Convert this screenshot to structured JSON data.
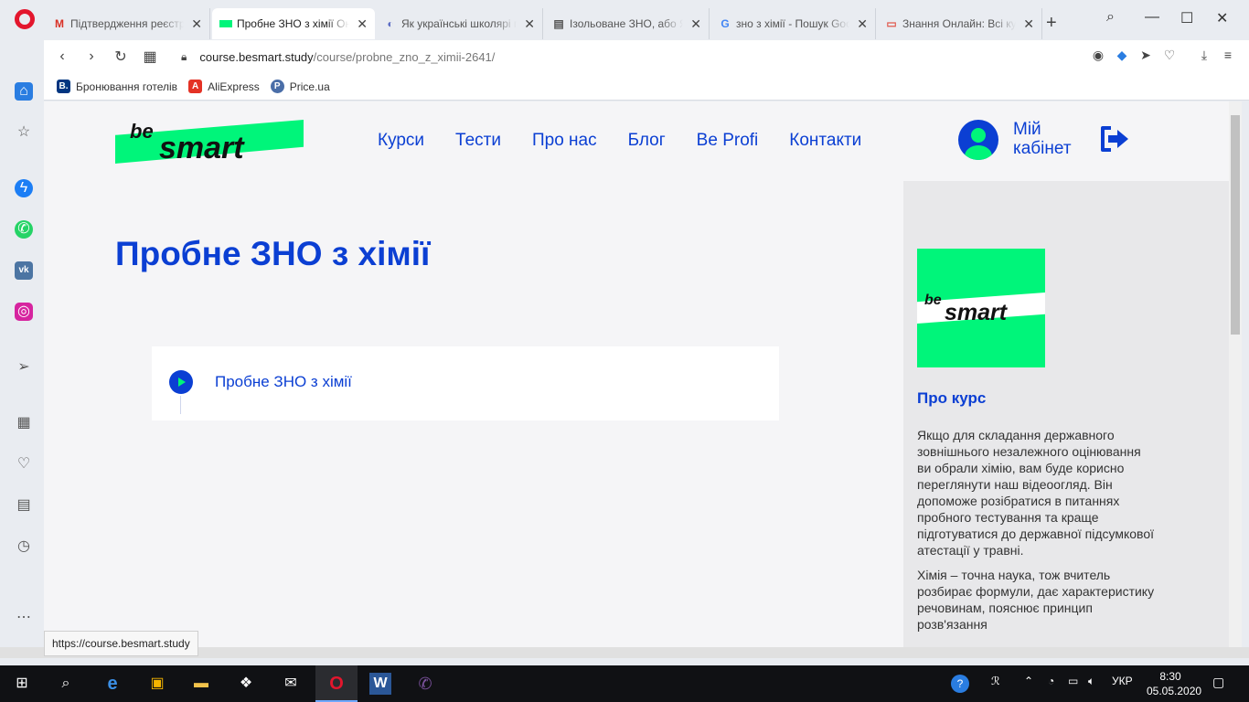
{
  "browser": {
    "tabs": [
      {
        "label": "Підтвердження реєстрації",
        "icon": "gmail-icon",
        "glyph": "M",
        "color": "#d93025"
      },
      {
        "label": "Пробне ЗНО з хімії Онлайн",
        "icon": "besmart-favicon",
        "glyph": "",
        "color": "#00f57a"
      },
      {
        "label": "Як українські школярі готуються",
        "icon": "news-favicon",
        "glyph": "◐",
        "color": "#5b6cc4"
      },
      {
        "label": "Ізольоване ЗНО, або Як",
        "icon": "document-favicon",
        "glyph": "▤",
        "color": "#555555"
      },
      {
        "label": "зно з хімії - Пошук Google",
        "icon": "google-icon",
        "glyph": "G",
        "color": "#4285f4"
      },
      {
        "label": "Знання Онлайн: Всі курси",
        "icon": "site-favicon",
        "glyph": "▭",
        "color": "#e05a4f"
      }
    ],
    "url_host": "course.besmart.study",
    "url_path": "/course/probne_zno_z_ximii-2641/",
    "bookmarks": [
      {
        "label": "Бронювання готелів",
        "glyph": "B.",
        "color": "#003580"
      },
      {
        "label": "AliExpress",
        "glyph": "A",
        "color": "#e43225"
      },
      {
        "label": "Price.ua",
        "glyph": "P",
        "color": "#4a6ea8"
      }
    ],
    "status_url": "https://course.besmart.study"
  },
  "site": {
    "logo_be": "be",
    "logo_smart": "smart",
    "nav": [
      "Курси",
      "Тести",
      "Про нас",
      "Блог",
      "Be Profi",
      "Контакти"
    ],
    "cabinet_label": "Мій кабінет",
    "page_title": "Пробне ЗНО з хімії",
    "lesson_label": "Пробне ЗНО з хімії",
    "side": {
      "logo_be": "be",
      "logo_smart": "smart",
      "about_title": "Про курс",
      "about_p1": "Якщо для складання державного зовнішнього незалежного оцінювання ви обрали хімію, вам буде корисно переглянути наш відеоогляд. Він допоможе розібратися в питаннях пробного тестування та краще підготуватися до державної підсумкової атестації у травні.",
      "about_p2": "Хімія – точна наука, тож вчитель розбирає формули, дає характеристику речовинам, пояснює принцип розв'язання"
    },
    "brand_blue": "#0b3fd3",
    "brand_green": "#00f57a"
  },
  "taskbar": {
    "language": "УКР",
    "time": "8:30",
    "date": "05.05.2020"
  }
}
